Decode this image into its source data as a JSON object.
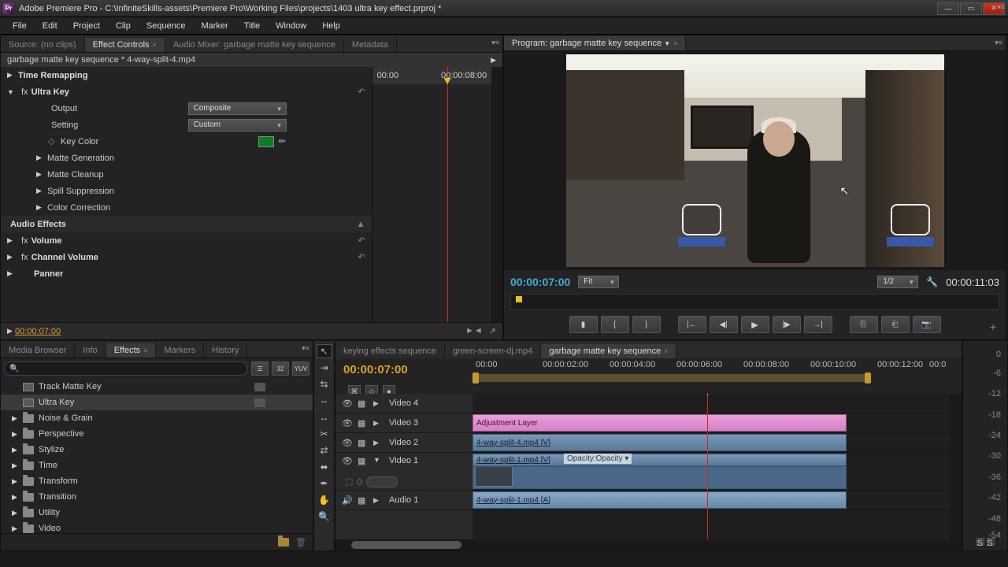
{
  "titlebar": {
    "title": "Adobe Premiere Pro - C:\\InfiniteSkills-assets\\Premiere Pro\\Working Files\\projects\\1403 ultra key effect.prproj *"
  },
  "menu": [
    "File",
    "Edit",
    "Project",
    "Clip",
    "Sequence",
    "Marker",
    "Title",
    "Window",
    "Help"
  ],
  "top_tabs": {
    "source": "Source: (no clips)",
    "ec": "Effect Controls",
    "mixer": "Audio Mixer: garbage matte key sequence",
    "meta": "Metadata"
  },
  "ec": {
    "header": "garbage matte key sequence * 4-way-split-4.mp4",
    "ruler_start": "00:00",
    "ruler_end": "00:00:08:00",
    "rows": {
      "time_remap": "Time Remapping",
      "ultra_key": "Ultra Key",
      "output": "Output",
      "output_val": "Composite",
      "setting": "Setting",
      "setting_val": "Custom",
      "key_color": "Key Color",
      "matte_gen": "Matte Generation",
      "matte_clean": "Matte Cleanup",
      "spill": "Spill Suppression",
      "color_corr": "Color Correction",
      "audio_fx": "Audio Effects",
      "volume": "Volume",
      "chan_vol": "Channel Volume",
      "panner": "Panner"
    },
    "footer_tc": "00:00:07:00"
  },
  "program": {
    "tab": "Program: garbage matte key sequence",
    "tc_current": "00:00:07:00",
    "fit": "Fit",
    "half": "1/2",
    "tc_duration": "00:00:11:03"
  },
  "effects_tabs": {
    "media": "Media Browser",
    "info": "Info",
    "effects": "Effects",
    "markers": "Markers",
    "history": "History"
  },
  "effects_buttons": {
    "fx": "☰",
    "num": "32",
    "yuv": "YUV"
  },
  "effects_tree": [
    {
      "type": "preset",
      "label": "Track Matte Key",
      "badge": true
    },
    {
      "type": "preset",
      "label": "Ultra Key",
      "badge": true,
      "sel": true
    },
    {
      "type": "folder",
      "label": "Noise & Grain"
    },
    {
      "type": "folder",
      "label": "Perspective"
    },
    {
      "type": "folder",
      "label": "Stylize"
    },
    {
      "type": "folder",
      "label": "Time"
    },
    {
      "type": "folder",
      "label": "Transform"
    },
    {
      "type": "folder",
      "label": "Transition"
    },
    {
      "type": "folder",
      "label": "Utility"
    },
    {
      "type": "folder",
      "label": "Video"
    }
  ],
  "timeline": {
    "tabs": [
      "keying effects sequence",
      "green-screen-dj.mp4",
      "garbage matte key sequence"
    ],
    "tc": "00:00:07:00",
    "ruler": [
      "00:00",
      "00:00:02:00",
      "00:00:04:00",
      "00:00:06:00",
      "00:00:08:00",
      "00:00:10:00",
      "00:00:12:00",
      "00:0"
    ],
    "tracks": {
      "v4": "Video 4",
      "v3": "Video 3",
      "v2": "Video 2",
      "v1": "Video 1",
      "a1": "Audio 1"
    },
    "clips": {
      "adj": "Adjustment Layer",
      "split4": "4-way-split-4.mp4 [V]",
      "split1v": "4-way-split-1.mp4 [V]",
      "opacity": "Opacity:Opacity ▾",
      "split1a": "4-way-split-1.mp4 [A]"
    }
  },
  "meters": {
    "ticks": [
      "0",
      "-6",
      "-12",
      "-18",
      "-24",
      "-30",
      "-36",
      "-42",
      "-48",
      "-54"
    ]
  }
}
